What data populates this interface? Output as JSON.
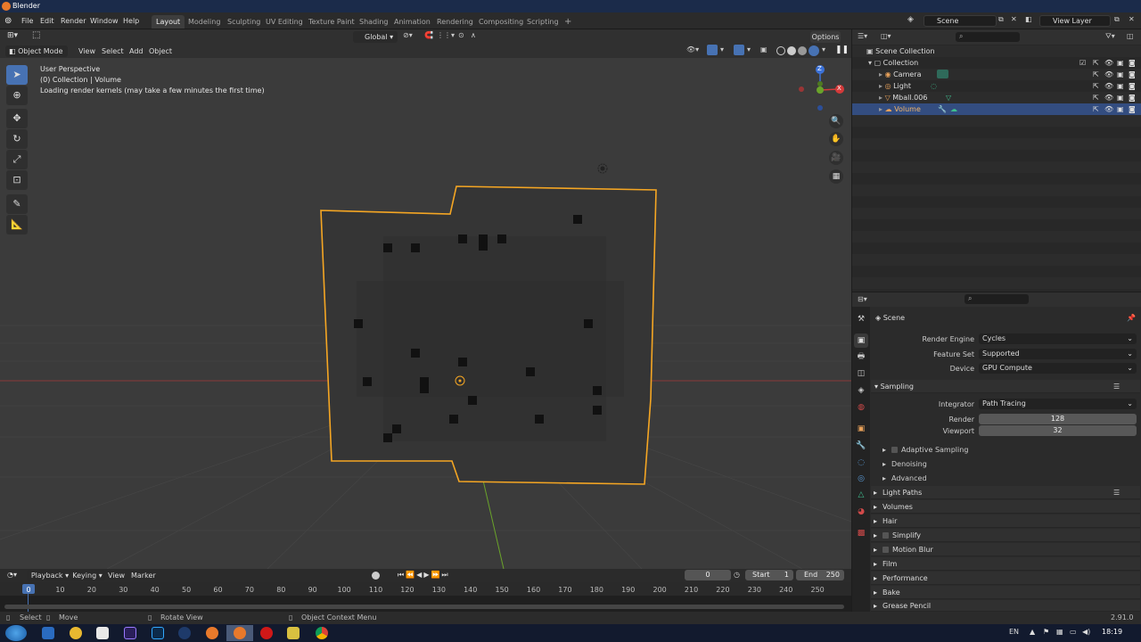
{
  "window": {
    "title": "Blender"
  },
  "menus": [
    "File",
    "Edit",
    "Render",
    "Window",
    "Help"
  ],
  "workspaces": [
    "Layout",
    "Modeling",
    "Sculpting",
    "UV Editing",
    "Texture Paint",
    "Shading",
    "Animation",
    "Rendering",
    "Compositing",
    "Scripting"
  ],
  "active_workspace": "Layout",
  "top_right": {
    "scene": "Scene",
    "view_layer": "View Layer"
  },
  "viewport_header": {
    "transform_orientation": "Global",
    "options_label": "Options",
    "mode": "Object Mode",
    "menus": [
      "View",
      "Select",
      "Add",
      "Object"
    ]
  },
  "viewport": {
    "overlay_lines": [
      "User Perspective",
      "(0) Collection | Volume",
      "Loading render kernels (may take a few minutes the first time)"
    ],
    "gizmo_axes": {
      "z": "Z",
      "x": "X"
    }
  },
  "outliner": {
    "root": "Scene Collection",
    "items": [
      {
        "label": "Collection",
        "indent": 1,
        "color": "#cfcfcf"
      },
      {
        "label": "Camera",
        "indent": 2,
        "color": "#e8a15a"
      },
      {
        "label": "Light",
        "indent": 2,
        "color": "#e8a15a"
      },
      {
        "label": "Mball.006",
        "indent": 2,
        "color": "#e8a15a"
      },
      {
        "label": "Volume",
        "indent": 2,
        "color": "#e8a15a",
        "selected": true
      }
    ]
  },
  "properties": {
    "context": "Scene",
    "render_engine_label": "Render Engine",
    "render_engine": "Cycles",
    "feature_set_label": "Feature Set",
    "feature_set": "Supported",
    "device_label": "Device",
    "device": "GPU Compute",
    "sampling": {
      "title": "Sampling",
      "integrator_label": "Integrator",
      "integrator": "Path Tracing",
      "render_label": "Render",
      "render": "128",
      "viewport_label": "Viewport",
      "viewport": "32",
      "subpanels": [
        "Adaptive Sampling",
        "Denoising",
        "Advanced"
      ]
    },
    "panels": [
      "Light Paths",
      "Volumes",
      "Hair",
      "Simplify",
      "Motion Blur",
      "Film",
      "Performance",
      "Bake",
      "Grease Pencil"
    ]
  },
  "timeline": {
    "menus": [
      "Playback",
      "Keying",
      "View",
      "Marker"
    ],
    "current_frame": "0",
    "start_label": "Start",
    "start": "1",
    "end_label": "End",
    "end": "250",
    "ticks": [
      "0",
      "10",
      "20",
      "30",
      "40",
      "50",
      "60",
      "70",
      "80",
      "90",
      "100",
      "110",
      "120",
      "130",
      "140",
      "150",
      "160",
      "170",
      "180",
      "190",
      "200",
      "210",
      "220",
      "230",
      "240",
      "250"
    ]
  },
  "statusbar": {
    "select": "Select",
    "move": "Move",
    "rotate": "Rotate View",
    "context_menu": "Object Context Menu",
    "version": "2.91.0"
  },
  "taskbar": {
    "lang": "EN",
    "time": "18:19"
  },
  "colors": {
    "accent": "#4772b3",
    "selection_outline": "#f5a623",
    "header": "#303030",
    "viewport_bg": "#3b3b3b"
  }
}
